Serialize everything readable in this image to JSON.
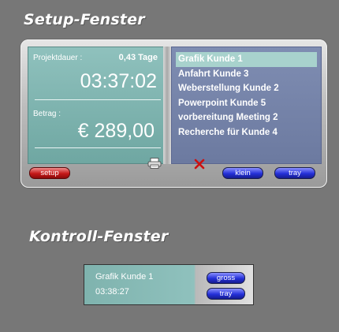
{
  "setup_title": "Setup-Fenster",
  "control_title": "Kontroll-Fenster",
  "setup": {
    "left": {
      "duration_label": "Projektdauer :",
      "duration_days": "0,43 Tage",
      "elapsed_time": "03:37:02",
      "amount_label": "Betrag :",
      "amount_value": "€ 289,00"
    },
    "tasks": [
      {
        "label": "Grafik Kunde 1",
        "active": true
      },
      {
        "label": "Anfahrt Kunde 3"
      },
      {
        "label": "Weberstellung Kunde 2"
      },
      {
        "label": "Powerpoint Kunde 5"
      },
      {
        "label": "vorbereitung Meeting 2"
      },
      {
        "label": "Recherche für Kunde 4"
      }
    ],
    "buttons": {
      "setup": "setup",
      "klein": "klein",
      "tray": "tray"
    },
    "icons": {
      "printer": "printer-icon",
      "close": "close-icon",
      "close_color": "#cc1111"
    }
  },
  "control": {
    "task": "Grafik Kunde 1",
    "time": "03:38:27",
    "buttons": {
      "gross": "gross",
      "tray": "tray"
    }
  }
}
